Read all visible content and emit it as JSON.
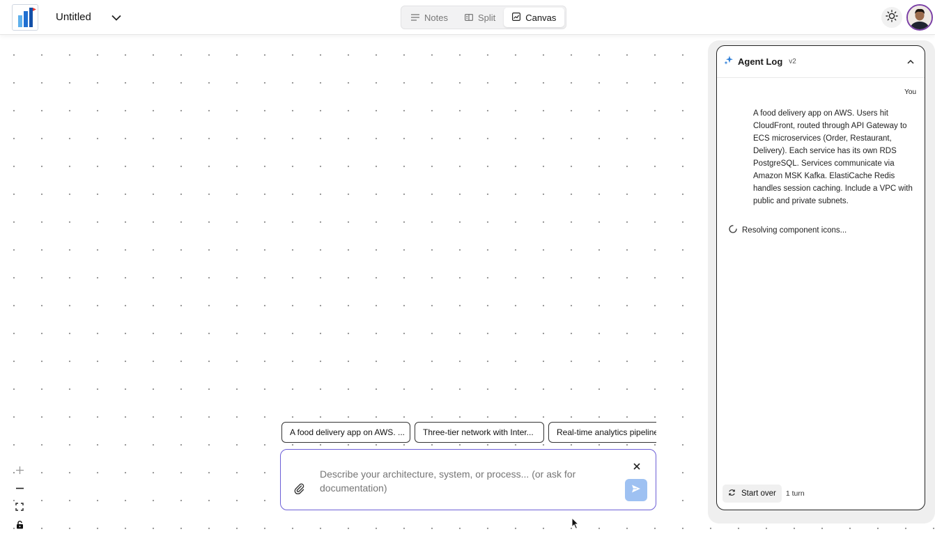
{
  "header": {
    "title": "Untitled",
    "logo_icon": "app-logo-icon",
    "views": [
      {
        "label": "Notes",
        "icon": "notes-icon",
        "active": false
      },
      {
        "label": "Split",
        "icon": "split-icon",
        "active": false
      },
      {
        "label": "Canvas",
        "icon": "canvas-icon",
        "active": true
      }
    ],
    "theme_icon": "sun-icon",
    "avatar_icon": "user-avatar"
  },
  "agent_log": {
    "title": "Agent Log",
    "version": "v2",
    "sender": "You",
    "message": "A food delivery app on AWS. Users hit CloudFront, routed through API Gateway to ECS microservices (Order, Restaurant, Delivery). Each service has its own RDS PostgreSQL. Services communicate via Amazon MSK Kafka. ElastiCache Redis handles session caching. Include a VPC with public and private subnets.",
    "status": "Resolving component icons...",
    "start_over_label": "Start over",
    "turn_count": "1 turn"
  },
  "suggestions": [
    "A food delivery app on AWS. ...",
    "Three-tier network with Inter...",
    "Real-time analytics pipeline:"
  ],
  "chat_input": {
    "placeholder": "Describe your architecture, system, or process... (or ask for documentation)"
  },
  "colors": {
    "accent": "#6c5fd6",
    "send_button": "#9ec1f2",
    "logo_blue": "#1f6fd1",
    "avatar_ring": "#7a3fa6"
  }
}
